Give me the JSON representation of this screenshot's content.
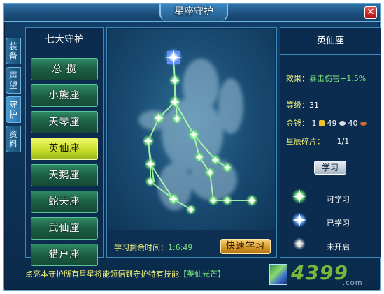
{
  "window": {
    "title": "星座守护",
    "close_label": "✕"
  },
  "side_tabs": [
    {
      "label": "装备",
      "chars": [
        "装",
        "备"
      ]
    },
    {
      "label": "声望",
      "chars": [
        "声",
        "望"
      ]
    },
    {
      "label": "守护",
      "chars": [
        "守",
        "护"
      ]
    },
    {
      "label": "资料",
      "chars": [
        "资",
        "料"
      ]
    }
  ],
  "active_side_tab": "守护",
  "left_panel": {
    "title": "七大守护",
    "items": [
      "总  揽",
      "小熊座",
      "天琴座",
      "英仙座",
      "天鹅座",
      "蛇夫座",
      "武仙座",
      "猎户座"
    ],
    "selected": "英仙座"
  },
  "star_map": {
    "timer_label": "学习剩余时间：",
    "timer_value": "1:6:49",
    "fast_learn_label": "快速学习",
    "colors": {
      "learnable": "#7dff7d",
      "learned": "#4fa7ff",
      "locked": "#c8c8c8"
    }
  },
  "details": {
    "title": "英仙座",
    "effect_label": "效果：",
    "effect_value": "暴击伤害+1.5%",
    "level_label": "等级：",
    "level_value": "31",
    "money_label": "金钱：",
    "money_gold": "1",
    "money_silver": "49",
    "money_copper": "40",
    "shard_label": "星辰碎片：",
    "shard_value": "1/1",
    "learn_label": "学习"
  },
  "legend": [
    {
      "icon": "green-star-icon",
      "label": "可学习"
    },
    {
      "icon": "blue-star-icon",
      "label": "已学习"
    },
    {
      "icon": "grey-star-icon",
      "label": "未开启"
    }
  ],
  "footer": {
    "text": "点亮本守护所有星星将能领悟到守护特有技能",
    "skill_name": "【英仙光芒】"
  },
  "watermark": {
    "text": "4399",
    "domain": ".com"
  }
}
